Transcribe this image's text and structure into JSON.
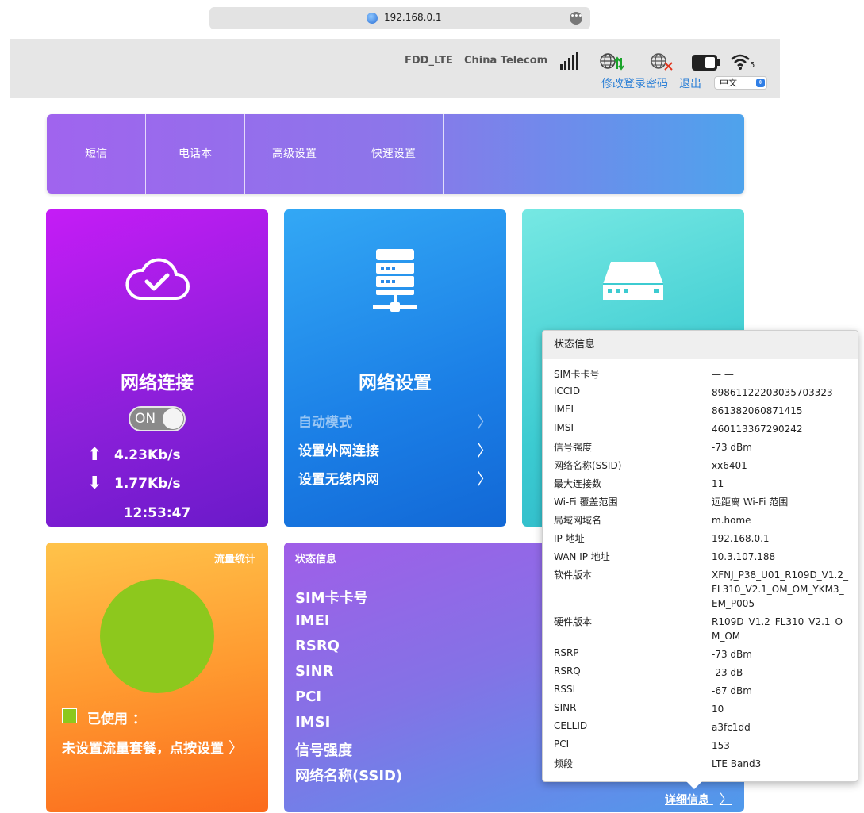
{
  "browser": {
    "url": "192.168.0.1"
  },
  "header": {
    "network_type": "FDD_LTE",
    "carrier": "China Telecom",
    "wifi_count": "5",
    "change_password": "修改登录密码",
    "logout": "退出",
    "language": "中文",
    "icons": [
      "signal-bars-icon",
      "internet-connected-icon",
      "wan-disconnected-icon",
      "battery-icon",
      "wifi-icon"
    ]
  },
  "nav": {
    "items": [
      "短信",
      "电话本",
      "高级设置",
      "快速设置"
    ]
  },
  "network": {
    "title": "网络连接",
    "toggle": "ON",
    "upload": "4.23Kb/s",
    "download": "1.77Kb/s",
    "time": "12:53:47"
  },
  "settings": {
    "title": "网络设置",
    "items": [
      "自动模式",
      "设置外网连接",
      "设置无线内网"
    ]
  },
  "traffic": {
    "title": "流量统计",
    "used": "已使用 ：",
    "plan": "未设置流量套餐，点按设置",
    "color": "#8dc81d"
  },
  "status": {
    "title": "状态信息",
    "items": [
      "SIM卡卡号",
      "IMEI",
      "RSRQ",
      "SINR",
      "PCI",
      "IMSI",
      "信号强度",
      "网络名称(SSID)"
    ],
    "detail": "详细信息"
  },
  "popup": {
    "title": "状态信息",
    "rows": [
      {
        "k": "SIM卡卡号",
        "v": "— —"
      },
      {
        "k": "ICCID",
        "v": "89861122203035703323"
      },
      {
        "k": "IMEI",
        "v": "861382060871415"
      },
      {
        "k": "IMSI",
        "v": "460113367290242"
      },
      {
        "k": "信号强度",
        "v": "-73 dBm"
      },
      {
        "k": "网络名称(SSID)",
        "v": "xx6401"
      },
      {
        "k": "最大连接数",
        "v": "11"
      },
      {
        "k": "Wi-Fi 覆盖范围",
        "v": "远距离 Wi-Fi 范围"
      },
      {
        "k": "局域网域名",
        "v": "m.home"
      },
      {
        "k": "IP 地址",
        "v": "192.168.0.1"
      },
      {
        "k": "WAN IP 地址",
        "v": "10.3.107.188"
      },
      {
        "k": "软件版本",
        "v": "XFNJ_P38_U01_R109D_V1.2_FL310_V2.1_OM_OM_YKM3_EM_P005"
      },
      {
        "k": "硬件版本",
        "v": "R109D_V1.2_FL310_V2.1_OM_OM"
      },
      {
        "k": "RSRP",
        "v": "-73 dBm"
      },
      {
        "k": "RSRQ",
        "v": "-23 dB"
      },
      {
        "k": "RSSI",
        "v": "-67 dBm"
      },
      {
        "k": "SINR",
        "v": "10"
      },
      {
        "k": "CELLID",
        "v": "a3fc1dd"
      },
      {
        "k": "PCI",
        "v": "153"
      },
      {
        "k": "频段",
        "v": "LTE Band3"
      }
    ]
  }
}
